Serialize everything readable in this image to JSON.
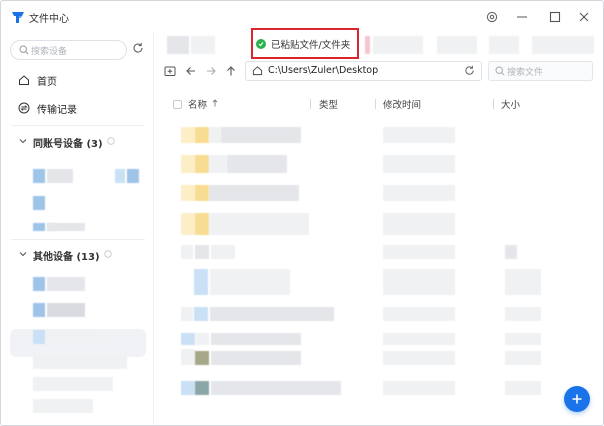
{
  "app": {
    "title": "文件中心"
  },
  "window_controls": [
    "settings-icon",
    "minimize-icon",
    "maximize-icon",
    "close-icon"
  ],
  "sidebar": {
    "search_placeholder": "搜索设备",
    "nav": [
      {
        "label": "首页",
        "icon": "home-icon"
      },
      {
        "label": "传输记录",
        "icon": "transfer-icon"
      }
    ],
    "groups": [
      {
        "title": "同账号设备 (3)"
      },
      {
        "title": "其他设备 (13)"
      }
    ]
  },
  "toast": {
    "message": "已粘贴文件/文件夹",
    "icon": "check-circle-icon",
    "color": "#2bb24c"
  },
  "toolbar": {
    "path": "C:\\Users\\Zuler\\Desktop",
    "search_placeholder": "搜索文件",
    "buttons": [
      "new-folder-icon",
      "back-icon",
      "forward-icon",
      "up-icon"
    ]
  },
  "columns": {
    "name": "名称",
    "type": "类型",
    "modified": "修改时间",
    "size": "大小"
  },
  "colors": {
    "accent": "#1a73e8",
    "highlight_border": "#d9262c",
    "success": "#2bb24c"
  }
}
